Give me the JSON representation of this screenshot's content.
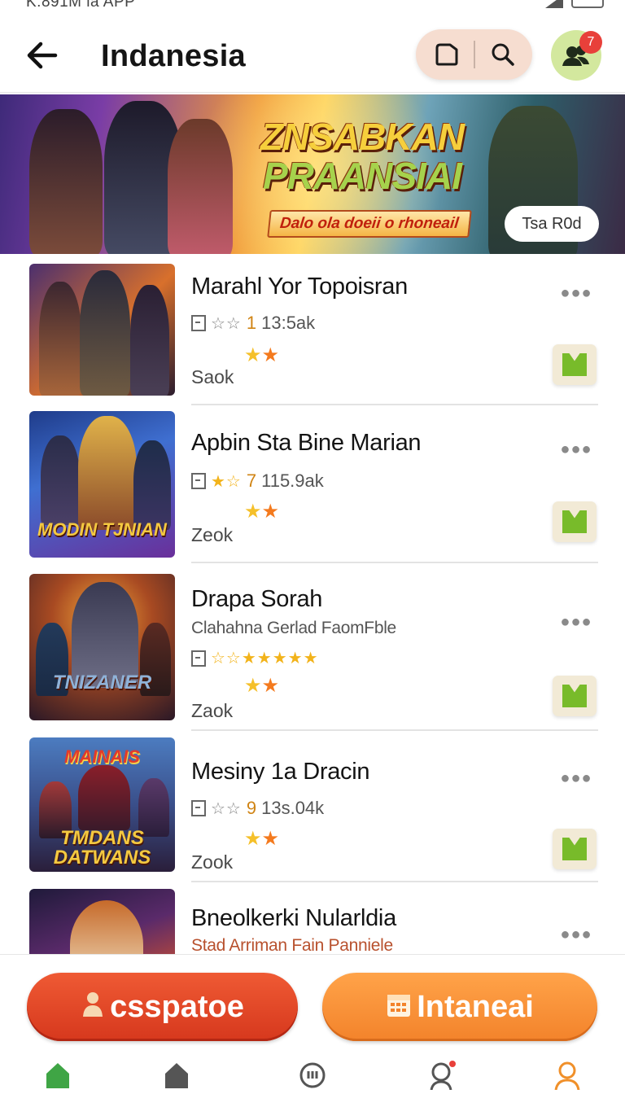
{
  "status": {
    "left_text": "K:891M la APP"
  },
  "header": {
    "title": "Indanesia",
    "badge_count": "7"
  },
  "banner": {
    "title_line1": "ZNSABKAN",
    "title_line2": "PRAANSIAI",
    "subtitle": "Dalo ola doeii o rhoneail",
    "cta_label": "Tsa R0d"
  },
  "games": [
    {
      "title": "Marahl Yor Topoisran",
      "rating_stars": "☆☆",
      "rank": "1",
      "count": "13:5ak",
      "tag": "Saok"
    },
    {
      "title": "Apbin Sta Bine Marian",
      "rating_stars": "★☆",
      "rank": "7",
      "count": "115.9ak",
      "tag": "Zeok",
      "thumb_text": "MODIN TJNIAN"
    },
    {
      "title": "Drapa Sorah",
      "subtitle": "Clahahna Gerlad FaomFble",
      "rating_stars": "☆☆★★★★★",
      "tag": "Zaok",
      "thumb_text": "TNIZANER"
    },
    {
      "title": "Mesiny 1a Dracin",
      "rating_stars": "☆☆",
      "rank": "9",
      "count": "13s.04k",
      "tag": "Zook",
      "thumb_text_top": "MAINAIS",
      "thumb_text": "TMDANS DATWANS"
    },
    {
      "title": "Bneolkerki Nularldia",
      "subtitle": "Stad Arriman Fain Panniele"
    }
  ],
  "actions": {
    "primary_label": "csspatoe",
    "secondary_label": "Intaneai"
  },
  "icons": {
    "back": "arrow-left-icon",
    "tab": "tab-icon",
    "search": "search-icon",
    "friends": "friends-icon",
    "more": "more-icon",
    "download": "download-icon",
    "home": "home-icon",
    "calendar": "calendar-icon",
    "person": "person-icon"
  },
  "colors": {
    "primary_button": "#d6381d",
    "secondary_button": "#f3832b",
    "accent_green": "#78bb2a",
    "tab_active": "#3fa545",
    "tab_profile": "#f0902a"
  }
}
